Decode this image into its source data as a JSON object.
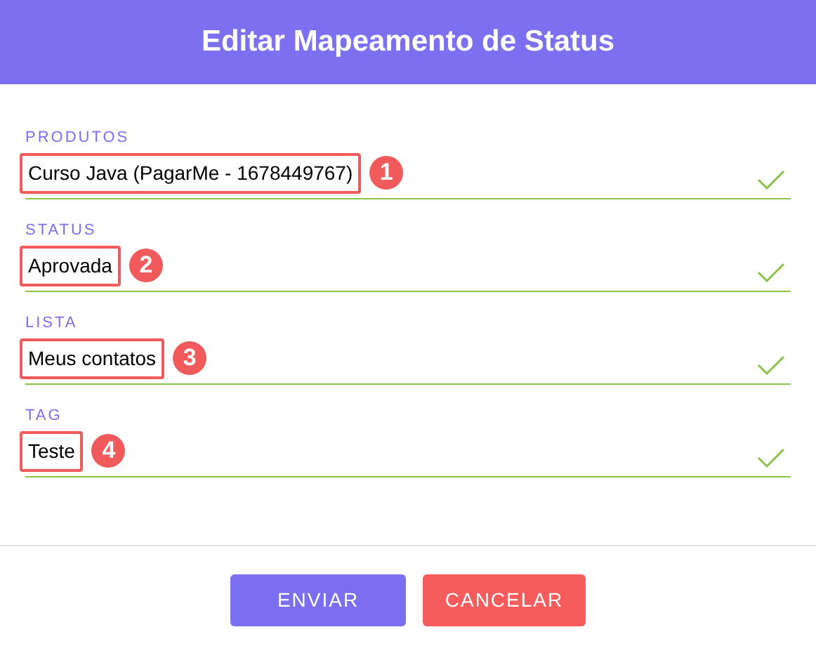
{
  "header": {
    "title": "Editar Mapeamento de Status"
  },
  "fields": [
    {
      "label": "PRODUTOS",
      "value": "Curso Java (PagarMe - 1678449767)",
      "marker": "1"
    },
    {
      "label": "STATUS",
      "value": "Aprovada",
      "marker": "2"
    },
    {
      "label": "LISTA",
      "value": "Meus contatos",
      "marker": "3"
    },
    {
      "label": "TAG",
      "value": "Teste",
      "marker": "4"
    }
  ],
  "buttons": [
    {
      "label": "ENVIAR",
      "kind": "primary"
    },
    {
      "label": "CANCELAR",
      "kind": "danger"
    }
  ]
}
